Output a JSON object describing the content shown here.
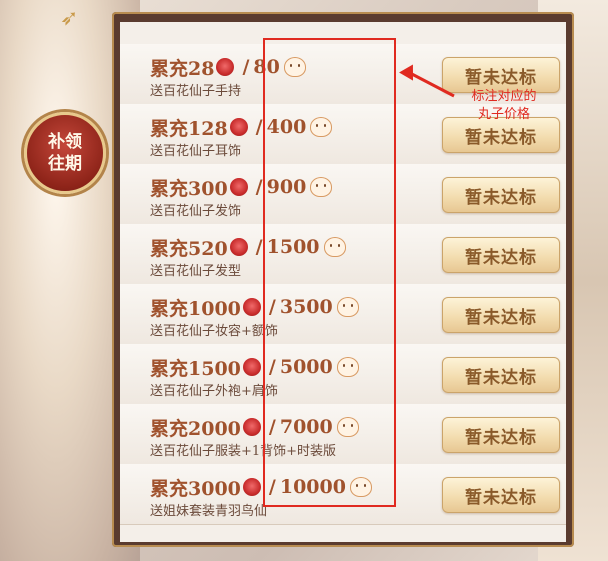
{
  "side_badge": {
    "line1": "补领",
    "line2": "往期"
  },
  "rows": [
    {
      "amount": "累充28",
      "price": "80",
      "reward": "送百花仙子手持",
      "button": "暂未达标"
    },
    {
      "amount": "累充128",
      "price": "400",
      "reward": "送百花仙子耳饰",
      "button": "暂未达标"
    },
    {
      "amount": "累充300",
      "price": "900",
      "reward": "送百花仙子发饰",
      "button": "暂未达标"
    },
    {
      "amount": "累充520",
      "price": "1500",
      "reward": "送百花仙子发型",
      "button": "暂未达标"
    },
    {
      "amount": "累充1000",
      "price": "3500",
      "reward": "送百花仙子妆容+额饰",
      "button": "暂未达标"
    },
    {
      "amount": "累充1500",
      "price": "5000",
      "reward": "送百花仙子外袍+肩饰",
      "button": "暂未达标"
    },
    {
      "amount": "累充2000",
      "price": "7000",
      "reward": "送百花仙子服装+1背饰+时装版",
      "button": "暂未达标"
    },
    {
      "amount": "累充3000",
      "price": "10000",
      "reward": "送姐妹套装青羽鸟仙",
      "button": "暂未达标"
    }
  ],
  "annotation": {
    "line1": "标注对应的",
    "line2": "丸子价格"
  },
  "colors": {
    "annotation": "#e02a20",
    "title": "#a0522d",
    "button_bg": "#f3ddb0"
  },
  "icons": {
    "currency_a": "rose-icon",
    "currency_b": "dango-icon"
  }
}
